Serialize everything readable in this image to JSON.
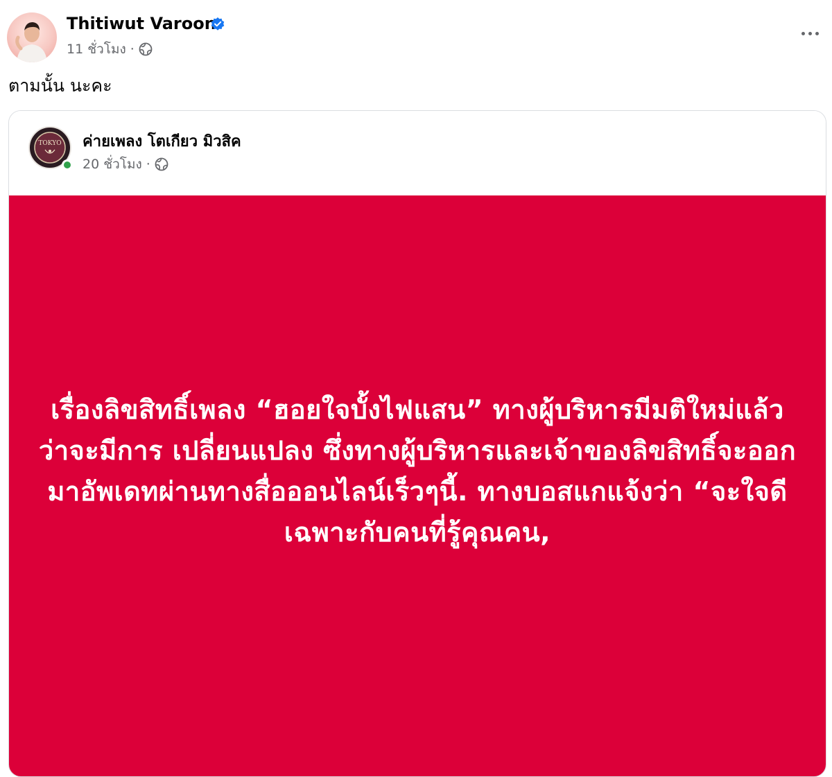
{
  "post": {
    "author": "Thitiwut Varoon",
    "time": "11 ชั่วโมง",
    "separator": "·",
    "caption": "ตามนั้น นะคะ"
  },
  "shared": {
    "page_name": "ค่ายเพลง โตเกียว มิวสิค",
    "time": "20 ชั่วโมง",
    "separator": "·",
    "logo_text": "TOKYO",
    "background_color": "#dc0039",
    "text_color": "#ffffff",
    "announcement": "เรื่องลิขสิทธิ์เพลง “ฮอยใจบั้งไฟแสน” ทางผู้บริหารมีมติใหม่แล้วว่าจะมีการ เปลี่ยนแปลง ซึ่งทางผู้บริหารและเจ้าของลิขสิทธิ์จะออกมาอัพเดทผ่านทางสื่อออนไลน์เร็วๆนี้. ทางบอสแกแจ้งว่า “จะใจดีเฉพาะกับคนที่รู้คุณคน,"
  },
  "icons": {
    "verified": "verified-badge-icon",
    "globe": "globe-icon",
    "more": "more-options-icon"
  },
  "colors": {
    "verified_blue": "#1877f2",
    "meta_gray": "#65676b",
    "online_green": "#31a24c"
  }
}
